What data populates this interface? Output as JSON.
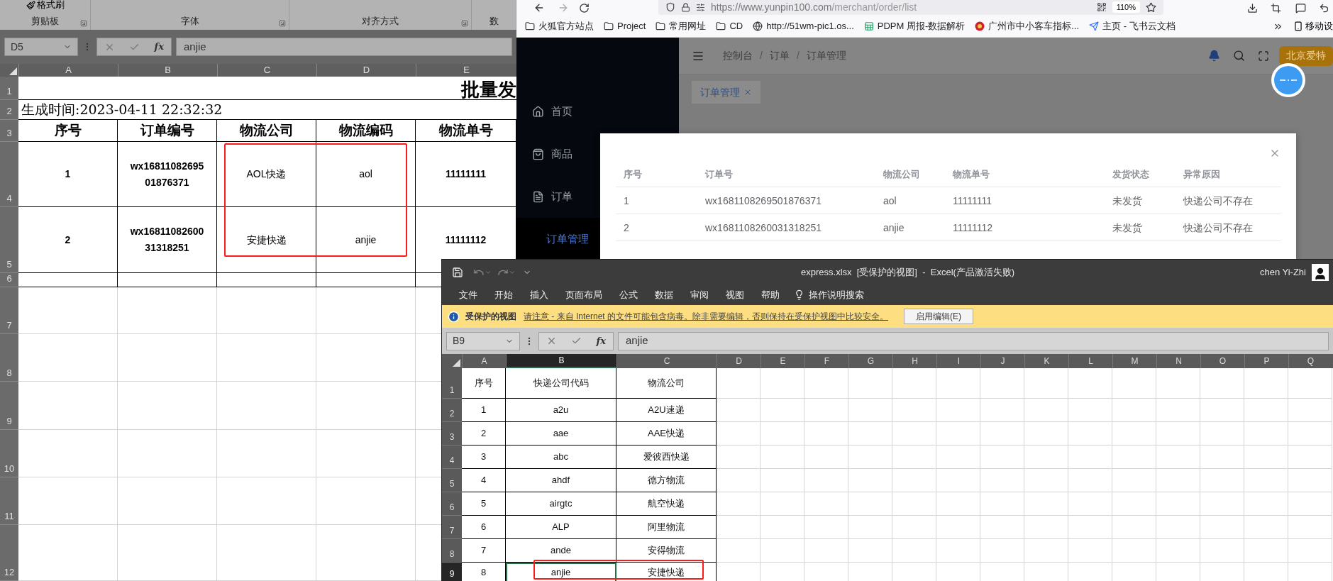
{
  "batch_sheet": {
    "format_painter": "格式刷",
    "ribbon_groups": [
      {
        "label": "剪贴板"
      },
      {
        "label": "字体"
      },
      {
        "label": "对齐方式"
      },
      {
        "label": "数"
      }
    ],
    "name_box": "D5",
    "function_label": "fx",
    "formula": "anjie",
    "columns": [
      "A",
      "B",
      "C",
      "D",
      "E"
    ],
    "row_numbers": [
      "1",
      "2",
      "3",
      "4",
      "5",
      "6",
      "7",
      "8",
      "9",
      "10",
      "11",
      "12"
    ],
    "title": "批量发",
    "generated": "生成时间:2023-04-11  22:32:32",
    "header": [
      "序号",
      "订单编号",
      "物流公司",
      "物流编码",
      "物流单号"
    ],
    "rows": [
      [
        "1",
        "wx1681108269501876371",
        "AOL快递",
        "aol",
        "11111111"
      ],
      [
        "2",
        "wx1681108260031318251",
        "安捷快递",
        "anjie",
        "11111112"
      ]
    ]
  },
  "browser": {
    "url_host": "https://www.yunpin100.com",
    "url_path": "/merchant/order/list",
    "zoom": "110%",
    "bookmarks": [
      {
        "label": "火狐官方站点",
        "kind": "folder"
      },
      {
        "label": "Project",
        "kind": "folder"
      },
      {
        "label": "常用网址",
        "kind": "folder"
      },
      {
        "label": "CD",
        "kind": "folder"
      },
      {
        "label": "http://51wm-pic1.os...",
        "kind": "globe"
      },
      {
        "label": "PDPM 周报-数据解析",
        "kind": "sheet"
      },
      {
        "label": "广州市中小客车指标...",
        "kind": "emblem"
      },
      {
        "label": "主页 - 飞书云文档",
        "kind": "feishu"
      }
    ],
    "mobile": "移动设",
    "sidebar": [
      {
        "label": "首页",
        "kind": "home",
        "selected": false
      },
      {
        "label": "商品",
        "kind": "bag",
        "selected": false
      },
      {
        "label": "订单",
        "kind": "doc",
        "selected": false
      },
      {
        "label": "订单管理",
        "kind": "sub",
        "selected": true
      }
    ],
    "breadcrumb": [
      "控制台",
      "订单",
      "订单管理"
    ],
    "breadcrumb_separator": "/",
    "user": "北京爱特",
    "tabs": [
      {
        "label": "订单管理",
        "selected": true
      }
    ],
    "dialog": {
      "columns": [
        "序号",
        "订单号",
        "物流公司",
        "物流单号",
        "发货状态",
        "异常原因"
      ],
      "rows": [
        [
          "1",
          "wx1681108269501876371",
          "aol",
          "11111111",
          "未发货",
          "快递公司不存在"
        ],
        [
          "2",
          "wx1681108260031318251",
          "anjie",
          "11111112",
          "未发货",
          "快递公司不存在"
        ]
      ]
    }
  },
  "express_sheet": {
    "title": "express.xlsx  [受保护的视图]  -  Excel(产品激活失败)",
    "user": "chen Yi-Zhi",
    "menu": [
      "文件",
      "开始",
      "插入",
      "页面布局",
      "公式",
      "数据",
      "审阅",
      "视图",
      "帮助"
    ],
    "search": "操作说明搜索",
    "protected": {
      "label": "受保护的视图",
      "message": "请注意 - 来自 Internet 的文件可能包含病毒。除非需要编辑，否则保持在受保护视图中比较安全。",
      "button": "启用编辑(E)"
    },
    "name_box": "B9",
    "function_label": "fx",
    "formula": "anjie",
    "columns": [
      {
        "label": "A",
        "selected": false
      },
      {
        "label": "B",
        "selected": true
      },
      {
        "label": "C",
        "selected": false
      },
      {
        "label": "D",
        "selected": false
      },
      {
        "label": "E",
        "selected": false
      },
      {
        "label": "F",
        "selected": false
      },
      {
        "label": "G",
        "selected": false
      },
      {
        "label": "H",
        "selected": false
      },
      {
        "label": "I",
        "selected": false
      },
      {
        "label": "J",
        "selected": false
      },
      {
        "label": "K",
        "selected": false
      },
      {
        "label": "L",
        "selected": false
      },
      {
        "label": "M",
        "selected": false
      },
      {
        "label": "N",
        "selected": false
      },
      {
        "label": "O",
        "selected": false
      },
      {
        "label": "P",
        "selected": false
      },
      {
        "label": "Q",
        "selected": false
      }
    ],
    "rows": [
      {
        "num": "1",
        "selected": false,
        "cells": [
          "序号",
          "快递公司代码",
          "物流公司"
        ]
      },
      {
        "num": "2",
        "selected": false,
        "cells": [
          "1",
          "a2u",
          "A2U速递"
        ]
      },
      {
        "num": "3",
        "selected": false,
        "cells": [
          "2",
          "aae",
          "AAE快递"
        ]
      },
      {
        "num": "4",
        "selected": false,
        "cells": [
          "3",
          "abc",
          "爱彼西快递"
        ]
      },
      {
        "num": "5",
        "selected": false,
        "cells": [
          "4",
          "ahdf",
          "德方物流"
        ]
      },
      {
        "num": "6",
        "selected": false,
        "cells": [
          "5",
          "airgtc",
          "航空快递"
        ]
      },
      {
        "num": "7",
        "selected": false,
        "cells": [
          "6",
          "ALP",
          "阿里物流"
        ]
      },
      {
        "num": "8",
        "selected": false,
        "cells": [
          "7",
          "ande",
          "安得物流"
        ]
      },
      {
        "num": "9",
        "selected": true,
        "cells": [
          "8",
          "anjie",
          "安捷快递"
        ]
      }
    ]
  }
}
